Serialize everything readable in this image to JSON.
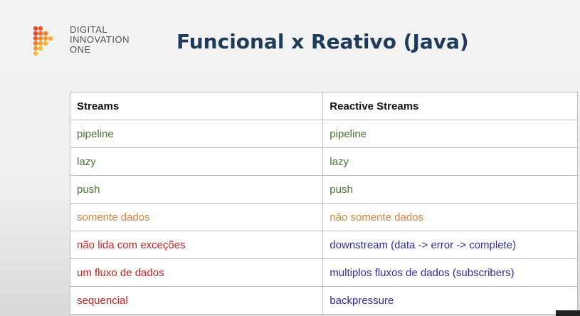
{
  "brand": {
    "lines": [
      "DIGITAL",
      "INNOVATION",
      "ONE"
    ],
    "icon": "dio-logo-icon"
  },
  "title": "Funcional x Reativo (Java)",
  "table": {
    "headers": [
      "Streams",
      "Reactive Streams"
    ],
    "rows": [
      {
        "left": "pipeline",
        "right": "pipeline",
        "color": "green"
      },
      {
        "left": "lazy",
        "right": "lazy",
        "color": "green"
      },
      {
        "left": "push",
        "right": "push",
        "color": "green"
      },
      {
        "left": "somente dados",
        "right": "não somente dados",
        "color": "orange"
      },
      {
        "left": "não lida com exceções",
        "right": "downstream (data -> error -> complete)",
        "color": "red-blue"
      },
      {
        "left": "um fluxo de dados",
        "right": "multiplos fluxos de dados (subscribers)",
        "color": "red-blue"
      },
      {
        "left": "sequencial",
        "right": "backpressure",
        "color": "red-blue"
      }
    ]
  },
  "colors": {
    "title": "#1e3b58",
    "green": "#4b7436",
    "orange": "#d4823f",
    "red": "#c02525",
    "blue": "#2d2d9a"
  }
}
